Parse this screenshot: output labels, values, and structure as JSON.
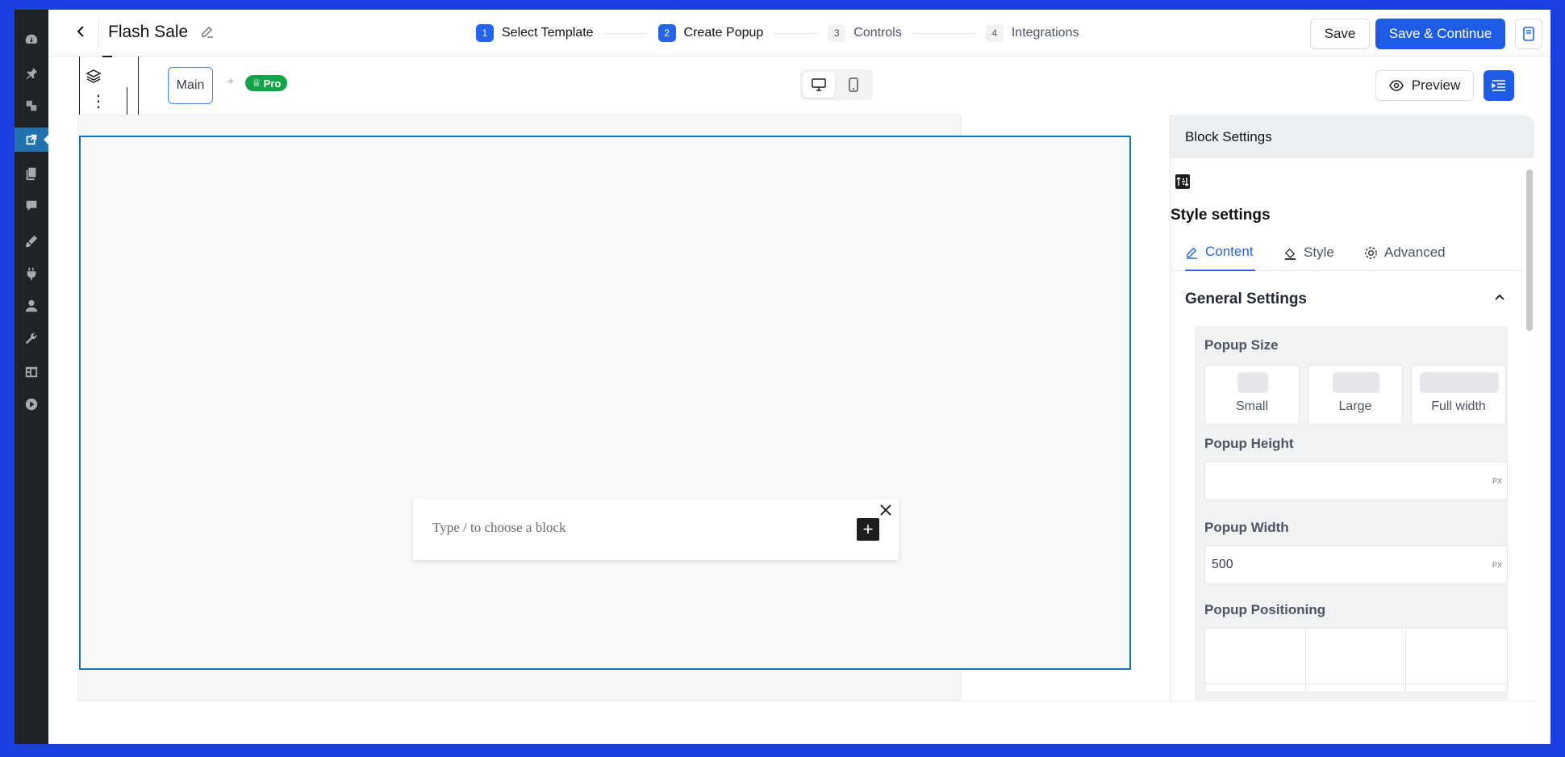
{
  "wp_menu": {
    "icons": [
      "dashboard-icon",
      "pin-icon",
      "media-icon",
      "popup-icon",
      "pages-icon",
      "comments-icon",
      "appearance-icon",
      "plugins-icon",
      "users-icon",
      "tools-icon",
      "settings-icon",
      "play-icon"
    ],
    "active_index": 3
  },
  "header": {
    "title": "Flash Sale",
    "steps": [
      {
        "num": "1",
        "label": "Select Template",
        "state": "done"
      },
      {
        "num": "2",
        "label": "Create Popup",
        "state": "current"
      },
      {
        "num": "3",
        "label": "Controls",
        "state": "pending"
      },
      {
        "num": "4",
        "label": "Integrations",
        "state": "pending"
      }
    ],
    "save_label": "Save",
    "save_continue_label": "Save & Continue"
  },
  "toolbar": {
    "main_tab_label": "Main",
    "add_symbol": "+",
    "pro_label": "Pro",
    "preview_label": "Preview"
  },
  "canvas": {
    "block_placeholder": "Type / to choose a block"
  },
  "settings": {
    "header_title": "Block Settings",
    "style_settings_title": "Style settings",
    "tabs": [
      {
        "label": "Content",
        "icon": "pencil-icon",
        "active": true
      },
      {
        "label": "Style",
        "icon": "paint-bucket-icon",
        "active": false
      },
      {
        "label": "Advanced",
        "icon": "gear-icon",
        "active": false
      }
    ],
    "section_title": "General Settings",
    "popup_size_label": "Popup Size",
    "size_options": [
      "Small",
      "Large",
      "Full width"
    ],
    "popup_height_label": "Popup Height",
    "popup_height_value": "",
    "popup_width_label": "Popup Width",
    "popup_width_value": "500",
    "unit": "PX",
    "popup_positioning_label": "Popup Positioning"
  },
  "colors": {
    "accent": "#2563eb",
    "frame_border": "#1a73b8",
    "pro_badge": "#15a34a",
    "outer_background": "#1a3fe0"
  }
}
